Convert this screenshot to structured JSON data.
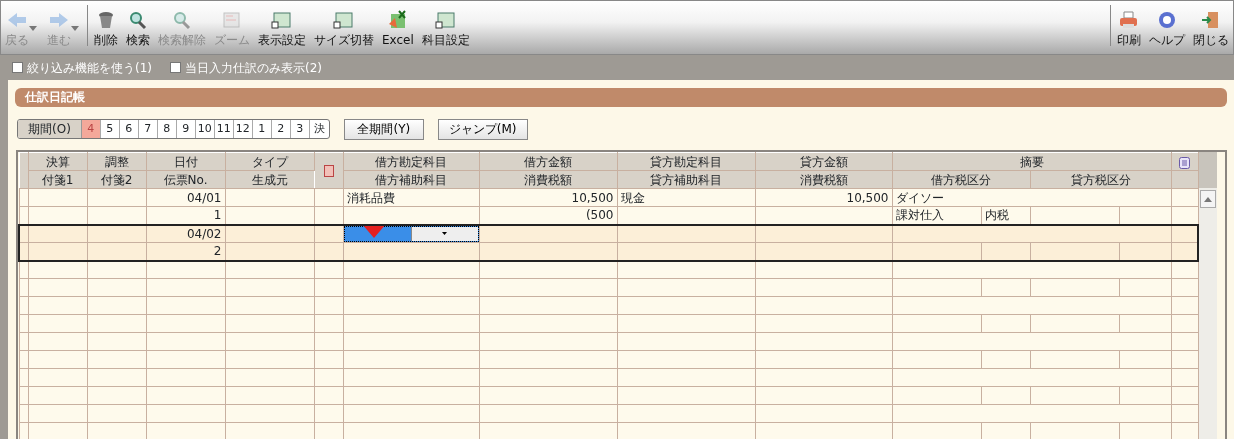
{
  "toolbar": {
    "left": [
      {
        "label": "戻る",
        "disabled": true,
        "dropdown": true
      },
      {
        "label": "進む",
        "disabled": true,
        "dropdown": true
      },
      {
        "label": "削除",
        "disabled": false,
        "dropdown": false
      },
      {
        "label": "検索",
        "disabled": false,
        "dropdown": false
      },
      {
        "label": "検索解除",
        "disabled": true,
        "dropdown": false
      },
      {
        "label": "ズーム",
        "disabled": true,
        "dropdown": false
      },
      {
        "label": "表示設定",
        "disabled": false,
        "dropdown": false
      },
      {
        "label": "サイズ切替",
        "disabled": false,
        "dropdown": false
      },
      {
        "label": "Excel",
        "disabled": false,
        "dropdown": false
      },
      {
        "label": "科目設定",
        "disabled": false,
        "dropdown": false
      }
    ],
    "right": [
      {
        "label": "印刷",
        "disabled": false,
        "dropdown": false
      },
      {
        "label": "ヘルプ",
        "disabled": false,
        "dropdown": false
      },
      {
        "label": "閉じる",
        "disabled": false,
        "dropdown": false
      }
    ]
  },
  "filters": [
    {
      "label": "絞り込み機能を使う(1)",
      "checked": false
    },
    {
      "label": "当日入力仕訳のみ表示(2)",
      "checked": false
    }
  ],
  "panel_title": "仕訳日記帳",
  "period": {
    "label": "期間(O)",
    "months": [
      {
        "label": "4",
        "selected": true
      },
      {
        "label": "5",
        "selected": false
      },
      {
        "label": "6",
        "selected": false
      },
      {
        "label": "7",
        "selected": false
      },
      {
        "label": "8",
        "selected": false
      },
      {
        "label": "9",
        "selected": false
      },
      {
        "label": "10",
        "selected": false
      },
      {
        "label": "11",
        "selected": false
      },
      {
        "label": "12",
        "selected": false
      },
      {
        "label": "1",
        "selected": false
      },
      {
        "label": "2",
        "selected": false
      },
      {
        "label": "3",
        "selected": false
      },
      {
        "label": "決",
        "selected": false
      }
    ]
  },
  "buttons": [
    "全期間(Y)",
    "ジャンプ(M)"
  ],
  "table": {
    "columns_top": [
      "決算",
      "調整",
      "日付",
      "タイプ",
      "借方勘定科目",
      "借方金額",
      "貸方勘定科目",
      "貸方金額",
      "摘要"
    ],
    "columns_bottom": [
      "付箋1",
      "付箋2",
      "伝票No.",
      "生成元",
      "借方補助科目",
      "消費税額",
      "貸方補助科目",
      "消費税額",
      "借方税区分",
      "貸方税区分"
    ],
    "rows": [
      {
        "date": "04/01",
        "number": "1",
        "debit_account": "消耗品費",
        "debit_amount": "10,500",
        "debit_tax": "(500",
        "credit_account": "現金",
        "credit_amount": "10,500",
        "summary": "ダイソー",
        "tax_category": "課対仕入",
        "tax_mode": "内税",
        "selected": false,
        "editing": false
      },
      {
        "date": "04/02",
        "number": "2",
        "selected": true,
        "editing": true
      }
    ]
  }
}
